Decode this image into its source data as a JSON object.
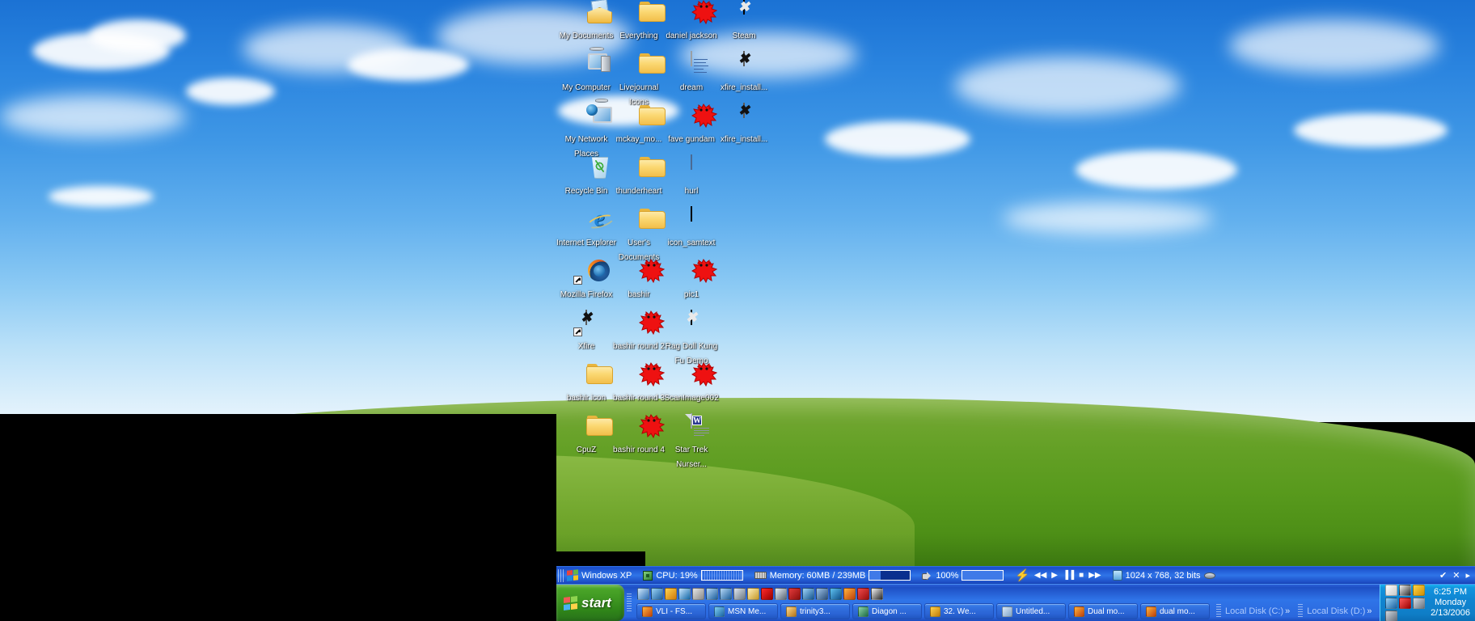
{
  "desktop": {
    "wallpaper_name": "Bliss",
    "icons": [
      {
        "label": "My Documents",
        "icon": "my-documents-icon",
        "type": "mydocs",
        "col": 0,
        "row": 0
      },
      {
        "label": "Everything",
        "icon": "folder-icon",
        "type": "folder",
        "col": 1,
        "row": 0
      },
      {
        "label": "daniel jackson",
        "icon": "red-splat-icon",
        "type": "splat",
        "col": 2,
        "row": 0
      },
      {
        "label": "Steam",
        "icon": "steam-shortcut-icon",
        "type": "dark",
        "col": 3,
        "row": 0
      },
      {
        "label": "My Computer",
        "icon": "my-computer-icon",
        "type": "pc",
        "col": 0,
        "row": 1
      },
      {
        "label": "Livejournal Icons",
        "icon": "folder-icon",
        "type": "folder",
        "col": 1,
        "row": 1
      },
      {
        "label": "dream",
        "icon": "text-document-icon",
        "type": "txt",
        "col": 2,
        "row": 1
      },
      {
        "label": "xfire_install...",
        "icon": "xfire-installer-icon",
        "type": "white",
        "col": 3,
        "row": 1
      },
      {
        "label": "My Network Places",
        "icon": "my-network-places-icon",
        "type": "net",
        "col": 0,
        "row": 2
      },
      {
        "label": "mckay_mo...",
        "icon": "folder-icon",
        "type": "folder",
        "col": 1,
        "row": 2
      },
      {
        "label": "fave gundam",
        "icon": "red-splat-icon",
        "type": "splat",
        "col": 2,
        "row": 2
      },
      {
        "label": "xfire_install...",
        "icon": "xfire-installer-icon",
        "type": "white",
        "col": 3,
        "row": 2
      },
      {
        "label": "Recycle Bin",
        "icon": "recycle-bin-icon",
        "type": "bin",
        "col": 0,
        "row": 3
      },
      {
        "label": "thunderheart",
        "icon": "folder-icon",
        "type": "folder",
        "col": 1,
        "row": 3
      },
      {
        "label": "hurl",
        "icon": "window-file-icon",
        "type": "win",
        "col": 2,
        "row": 3
      },
      {
        "label": "Internet Explorer",
        "icon": "internet-explorer-icon",
        "type": "ie",
        "col": 0,
        "row": 4
      },
      {
        "label": "User's Documents",
        "icon": "folder-icon",
        "type": "folder",
        "col": 1,
        "row": 4
      },
      {
        "label": "icon_samtext",
        "icon": "image-strip-icon",
        "type": "strip",
        "col": 2,
        "row": 4
      },
      {
        "label": "Mozilla Firefox",
        "icon": "mozilla-firefox-icon",
        "type": "ff",
        "col": 0,
        "row": 5,
        "shortcut": true
      },
      {
        "label": "bashir",
        "icon": "red-splat-icon",
        "type": "splat",
        "col": 1,
        "row": 5
      },
      {
        "label": "pic1",
        "icon": "red-splat-icon",
        "type": "splat",
        "col": 2,
        "row": 5
      },
      {
        "label": "Xfire",
        "icon": "xfire-icon",
        "type": "white",
        "col": 0,
        "row": 6,
        "shortcut": true
      },
      {
        "label": "bashir round 2",
        "icon": "red-splat-icon",
        "type": "splat",
        "col": 1,
        "row": 6
      },
      {
        "label": "Rag Doll Kung Fu Demo",
        "icon": "ragdoll-kungfu-icon",
        "type": "dark",
        "col": 2,
        "row": 6
      },
      {
        "label": "bashir icon",
        "icon": "folder-icon",
        "type": "folder",
        "col": 0,
        "row": 7
      },
      {
        "label": "bashir round 3",
        "icon": "red-splat-icon",
        "type": "splat",
        "col": 1,
        "row": 7
      },
      {
        "label": "ScanImage002",
        "icon": "red-splat-icon",
        "type": "splat",
        "col": 2,
        "row": 7
      },
      {
        "label": "CpuZ",
        "icon": "folder-icon",
        "type": "folder",
        "col": 0,
        "row": 8
      },
      {
        "label": "bashir round 4",
        "icon": "red-splat-icon",
        "type": "splat",
        "col": 1,
        "row": 8
      },
      {
        "label": "Star Trek Nurser...",
        "icon": "word-document-icon",
        "type": "doc",
        "col": 2,
        "row": 8
      }
    ]
  },
  "toolbar": {
    "windows_label": "Windows XP",
    "cpu_label": "CPU: 19%",
    "memory_label": "Memory: 60MB / 239MB",
    "volume_label": "100%",
    "display_label": "1024 x 768, 32 bits",
    "media_prev": "◀◀",
    "media_play": "▶",
    "media_pause": "▐▐",
    "media_stop": "■",
    "media_next": "▶▶",
    "check_mark": "✔",
    "close_mark": "✕",
    "overflow_mark": "▸"
  },
  "taskbar": {
    "start_label": "start",
    "quick_launch": [
      {
        "name": "show-desktop-icon",
        "color1": "#cfe6fa",
        "color2": "#2b6fb5"
      },
      {
        "name": "outlook-express-icon",
        "color1": "#9ad3f5",
        "color2": "#1c5f9e"
      },
      {
        "name": "xfire-quick-icon",
        "color1": "#ffd34d",
        "color2": "#d07a0a"
      },
      {
        "name": "media-player-icon",
        "color1": "#c7e6ff",
        "color2": "#1468a8"
      },
      {
        "name": "memory-monitor-icon",
        "color1": "#e5e5e5",
        "color2": "#8a8a8a"
      },
      {
        "name": "download-manager-icon",
        "color1": "#b5d8f7",
        "color2": "#1d5f9c"
      },
      {
        "name": "download-manager2-icon",
        "color1": "#b5d8f7",
        "color2": "#1d5f9c"
      },
      {
        "name": "cd-drive-icon",
        "color1": "#dde5ee",
        "color2": "#6e7a86"
      },
      {
        "name": "notepad-icon",
        "color1": "#fff0bb",
        "color2": "#c79a27"
      },
      {
        "name": "red-splat-quick-icon",
        "color1": "#ff2a2a",
        "color2": "#9b0000"
      },
      {
        "name": "disc-icon",
        "color1": "#e7eef7",
        "color2": "#5b6876"
      },
      {
        "name": "help-icon",
        "color1": "#e23b3b",
        "color2": "#8d0d0d"
      },
      {
        "name": "internet-explorer-quick-icon",
        "color1": "#9fd4f8",
        "color2": "#14558f"
      },
      {
        "name": "winamp-icon",
        "color1": "#9fc4e8",
        "color2": "#2b4f7a"
      },
      {
        "name": "msn-messenger-icon",
        "color1": "#5ec1ef",
        "color2": "#10528c"
      },
      {
        "name": "firefox-quick-icon",
        "color1": "#ffb43c",
        "color2": "#c0410d"
      },
      {
        "name": "opera-icon",
        "color1": "#ef4b4b",
        "color2": "#9a0d0d"
      },
      {
        "name": "xfire-launch-icon",
        "color1": "#f4f4f4",
        "color2": "#2a2a2a"
      }
    ],
    "tasks": [
      {
        "label": "VLI - FS...",
        "icon": "firefox-window-icon",
        "color1": "#ffb43c",
        "color2": "#c0410d"
      },
      {
        "label": "MSN Me...",
        "icon": "msn-messenger-window-icon",
        "color1": "#7fd0f3",
        "color2": "#1a63a3"
      },
      {
        "label": "trinity3...",
        "icon": "image-viewer-window-icon",
        "color1": "#ffd98a",
        "color2": "#b5761a"
      },
      {
        "label": "Diagon ...",
        "icon": "paint-window-icon",
        "color1": "#8ed4a8",
        "color2": "#1d6d45"
      },
      {
        "label": "32. We...",
        "icon": "xfire-window-icon",
        "color1": "#ffd34d",
        "color2": "#c07c0a"
      },
      {
        "label": "Untitled...",
        "icon": "notepad-window-icon",
        "color1": "#dceaf8",
        "color2": "#7ea4c9"
      },
      {
        "label": "Dual mo...",
        "icon": "firefox-window-icon",
        "color1": "#ffb43c",
        "color2": "#c0410d"
      },
      {
        "label": "dual mo...",
        "icon": "firefox-window-icon",
        "color1": "#ffb43c",
        "color2": "#c0410d"
      }
    ],
    "desk_bands": [
      {
        "label": "Local Disk (C:)",
        "chevron": "»"
      },
      {
        "label": "Local Disk (D:)",
        "chevron": "»"
      }
    ],
    "tray_icons": [
      {
        "name": "ff-deway-icon",
        "color1": "#ffffff",
        "color2": "#c8c8c8"
      },
      {
        "name": "xfire-tray-icon",
        "color1": "#f2f2f2",
        "color2": "#2f2f2f"
      },
      {
        "name": "smiley-tray-icon",
        "color1": "#ffd64a",
        "color2": "#d08d00"
      },
      {
        "name": "msn-contact-tray-icon",
        "color1": "#9ad3f5",
        "color2": "#1a63a3"
      },
      {
        "name": "network-disconnected-tray-icon",
        "color1": "#ff5a5a",
        "color2": "#9b0000"
      },
      {
        "name": "safely-remove-hardware-tray-icon",
        "color1": "#d6dde6",
        "color2": "#6a7480"
      },
      {
        "name": "volume-tray-icon",
        "color1": "#cfd6de",
        "color2": "#66707c"
      }
    ],
    "clock": {
      "time": "6:25 PM",
      "day": "Monday",
      "date": "2/13/2006"
    }
  }
}
